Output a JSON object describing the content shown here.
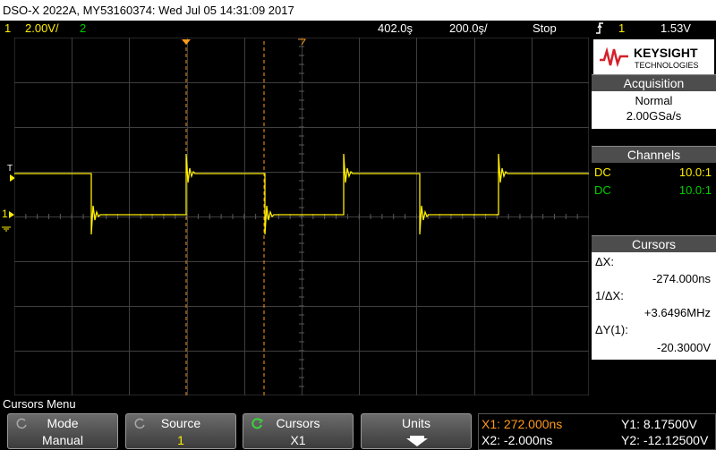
{
  "title_bar": "DSO-X 2022A, MY53160374: Wed Jul 05 14:31:09 2017",
  "status": {
    "ch1_num": "1",
    "ch1_scale": "2.00V/",
    "ch2_num": "2",
    "timebase": "402.0ş",
    "time_per_div": "200.0ş/",
    "run_state": "Stop",
    "trigger_source": "1",
    "trigger_level": "1.53V"
  },
  "markers": {
    "trigger_level_marker": "T",
    "ground_marker": "1",
    "ch1_label": "1"
  },
  "brand": {
    "name": "KEYSIGHT",
    "sub": "TECHNOLOGIES"
  },
  "acquisition": {
    "title": "Acquisition",
    "mode": "Normal",
    "rate": "2.00GSa/s"
  },
  "channels": {
    "title": "Channels",
    "rows": [
      {
        "coupling": "DC",
        "probe": "10.0:1",
        "color": "#ffee00"
      },
      {
        "coupling": "DC",
        "probe": "10.0:1",
        "color": "#00d000"
      }
    ]
  },
  "cursors": {
    "title": "Cursors",
    "dx_label": "ΔX:",
    "dx_value": "-274.000ns",
    "inv_dx_label": "1/ΔX:",
    "inv_dx_value": "+3.6496MHz",
    "dy_label": "ΔY(1):",
    "dy_value": "-20.3000V"
  },
  "menu": {
    "label": "Cursors Menu",
    "softkeys": [
      {
        "top": "Mode",
        "bottom": "Manual"
      },
      {
        "top": "Source",
        "bottom": "1"
      },
      {
        "top": "Cursors",
        "bottom": "X1"
      },
      {
        "top": "Units",
        "bottom": ""
      }
    ]
  },
  "readout": {
    "x1": "X1: 272.000ns",
    "x2": "X2: -2.000ns",
    "y1": "Y1: 8.17500V",
    "y2": "Y2: -12.12500V"
  },
  "colors": {
    "ch1": "#ffee00",
    "ch2": "#00d000",
    "cursor": "#ff9a1a",
    "grid": "#3f3f3f",
    "brand_red": "#d4202a"
  }
}
